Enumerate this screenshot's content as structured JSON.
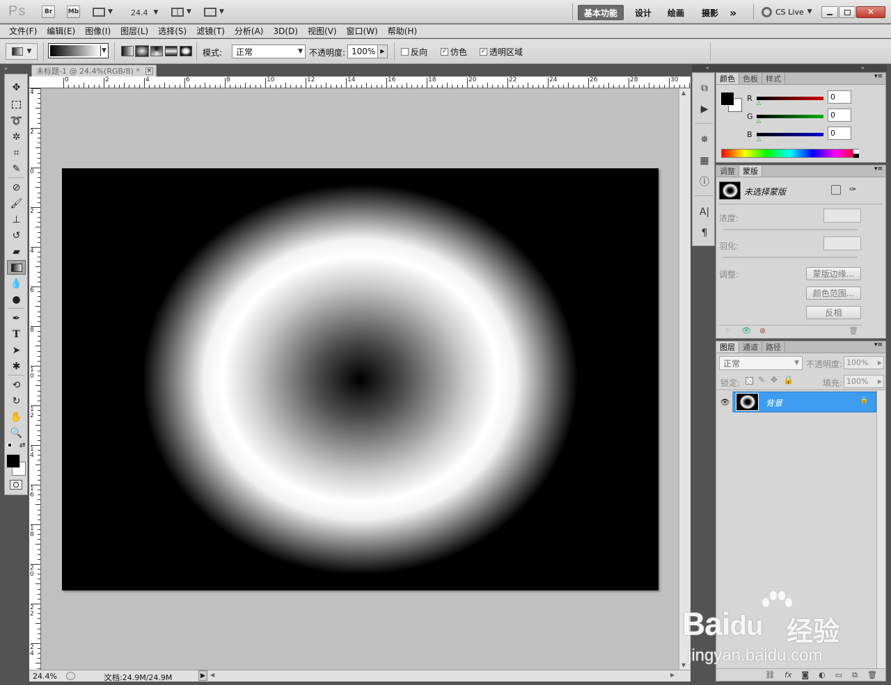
{
  "app": {
    "logo": "Ps",
    "bridge": "Br",
    "minibridge": "Mb",
    "zoom": "24.4"
  },
  "workspaces": [
    "基本功能",
    "设计",
    "绘画",
    "摄影"
  ],
  "more": "»",
  "cslive": "CS Live",
  "menu": [
    "文件(F)",
    "编辑(E)",
    "图像(I)",
    "图层(L)",
    "选择(S)",
    "滤镜(T)",
    "分析(A)",
    "3D(D)",
    "视图(V)",
    "窗口(W)",
    "帮助(H)"
  ],
  "options": {
    "mode_label": "模式:",
    "mode_value": "正常",
    "opacity_label": "不透明度:",
    "opacity_value": "100%",
    "reverse_label": "反向",
    "reverse_checked": false,
    "dither_label": "仿色",
    "dither_checked": true,
    "transparency_label": "透明区域",
    "transparency_checked": true
  },
  "document": {
    "tab_title": "未标题-1 @ 24.4%(RGB/8) *",
    "close": "×",
    "h_ruler": [
      "0",
      "2",
      "4",
      "6",
      "8",
      "10",
      "12",
      "14",
      "16",
      "18",
      "20",
      "22",
      "24",
      "26",
      "28",
      "30"
    ],
    "v_ruler": [
      "4",
      "2",
      "0",
      "2",
      "4",
      "6",
      "8",
      "1 0",
      "1 2",
      "1 4",
      "1 6",
      "1 8",
      "2 0",
      "2 2",
      "2 4"
    ],
    "status_zoom": "24.4%",
    "status_doc": "文档:24.9M/24.9M"
  },
  "color_panel": {
    "tabs": [
      "颜色",
      "色板",
      "样式"
    ],
    "channels": [
      {
        "label": "R",
        "value": "0",
        "color": "#d40000"
      },
      {
        "label": "G",
        "value": "0",
        "color": "#00b000"
      },
      {
        "label": "B",
        "value": "0",
        "color": "#0000d0"
      }
    ]
  },
  "masks_panel": {
    "tabs": [
      "调整",
      "蒙版"
    ],
    "no_mask": "未选择蒙版",
    "density_label": "浓度:",
    "feather_label": "羽化:",
    "refine_label": "调整:",
    "mask_edge_button": "蒙版边缘...",
    "color_range_button": "颜色范围...",
    "invert_button": "反相"
  },
  "layers_panel": {
    "tabs": [
      "图层",
      "通道",
      "路径"
    ],
    "blend_mode": "正常",
    "opacity_label": "不透明度:",
    "opacity_value": "100%",
    "lock_label": "锁定:",
    "fill_label": "填充:",
    "fill_value": "100%",
    "layer_name": "背景"
  },
  "watermark": {
    "brand": "Bai",
    "brand2": "du",
    "cn": "经验",
    "url": "jingyan.baidu.com"
  }
}
